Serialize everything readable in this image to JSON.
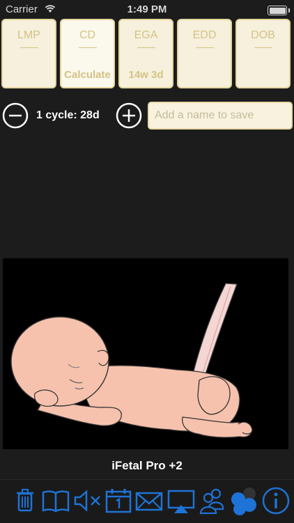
{
  "status_bar": {
    "carrier": "Carrier",
    "time": "1:49 PM"
  },
  "cards": [
    {
      "title": "LMP",
      "dashes": "-------",
      "value": ""
    },
    {
      "title": "CD",
      "dashes": "-------",
      "value": "Calculate"
    },
    {
      "title": "EGA",
      "dashes": "-------",
      "value": "14w 3d"
    },
    {
      "title": "EDD",
      "dashes": "-------",
      "value": ""
    },
    {
      "title": "DOB",
      "dashes": "-------",
      "value": ""
    }
  ],
  "cycle": {
    "label": "1 cycle: 28d"
  },
  "name_field": {
    "placeholder": "Add a name to save",
    "value": ""
  },
  "app_title": "iFetal Pro +2",
  "colors": {
    "accent_blue": "#1e73d6",
    "card_bg": "#f6f0dd",
    "card_border": "#e6d79e",
    "card_text": "#d4c285"
  },
  "toolbar": {
    "icons": [
      "trash-icon",
      "book-icon",
      "mute-icon",
      "calendar-icon",
      "mail-icon",
      "airplay-icon",
      "contacts-icon",
      "circles-icon",
      "info-icon"
    ]
  }
}
